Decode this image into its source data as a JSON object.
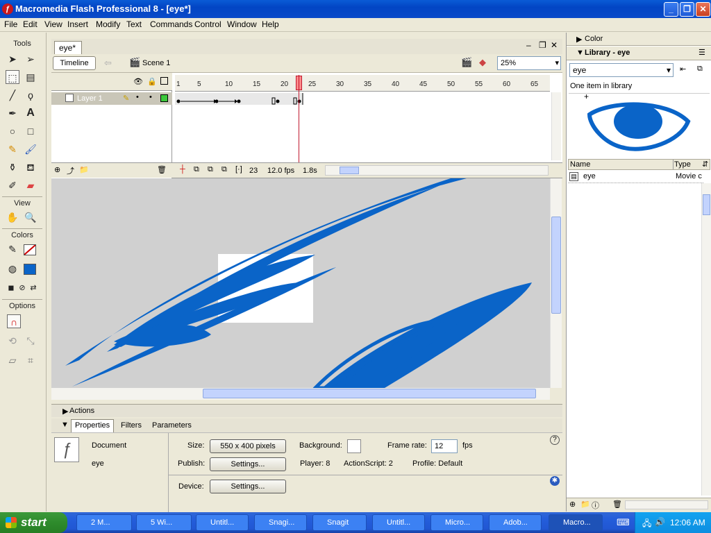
{
  "window": {
    "title": "Macromedia Flash Professional 8 - [eye*]"
  },
  "menu": [
    "File",
    "Edit",
    "View",
    "Insert",
    "Modify",
    "Text",
    "Commands",
    "Control",
    "Window",
    "Help"
  ],
  "tools": {
    "label": "Tools",
    "view_label": "View",
    "colors_label": "Colors",
    "options_label": "Options",
    "stroke_color": "#cc0000",
    "fill_color": "#0a64c8"
  },
  "document": {
    "tab": "eye*",
    "timeline_button": "Timeline",
    "scene": "Scene 1",
    "zoom": "25%"
  },
  "timeline": {
    "layer_name": "Layer 1",
    "ruler": [
      "1",
      "5",
      "10",
      "15",
      "20",
      "25",
      "30",
      "35",
      "40",
      "45",
      "50",
      "55",
      "60",
      "65"
    ],
    "current_frame": "23",
    "fps": "12.0 fps",
    "elapsed": "1.8s"
  },
  "panels": {
    "actions": "Actions",
    "tabs": [
      "Properties",
      "Filters",
      "Parameters"
    ]
  },
  "properties": {
    "type": "Document",
    "name": "eye",
    "size_label": "Size:",
    "size_value": "550 x 400 pixels",
    "background_label": "Background:",
    "frame_rate_label": "Frame rate:",
    "frame_rate": "12",
    "fps_unit": "fps",
    "publish_label": "Publish:",
    "settings_button": "Settings...",
    "player": "Player: 8",
    "actionscript": "ActionScript:  2",
    "profile": "Profile:  Default",
    "device_label": "Device:",
    "device_button": "Settings..."
  },
  "library": {
    "color_panel": "Color",
    "panel_title": "Library - eye",
    "selected": "eye",
    "count": "One item in library",
    "col_name": "Name",
    "col_type": "Type",
    "item_name": "eye",
    "item_type": "Movie c"
  },
  "taskbar": {
    "start": "start",
    "tasks": [
      "2 M...",
      "5 Wi...",
      "Untitl...",
      "Snagi...",
      "Snagit",
      "Untitl...",
      "Micro...",
      "Adob...",
      "Macro..."
    ],
    "clock": "12:06 AM"
  },
  "colors": {
    "accent": "#0a64c8"
  }
}
